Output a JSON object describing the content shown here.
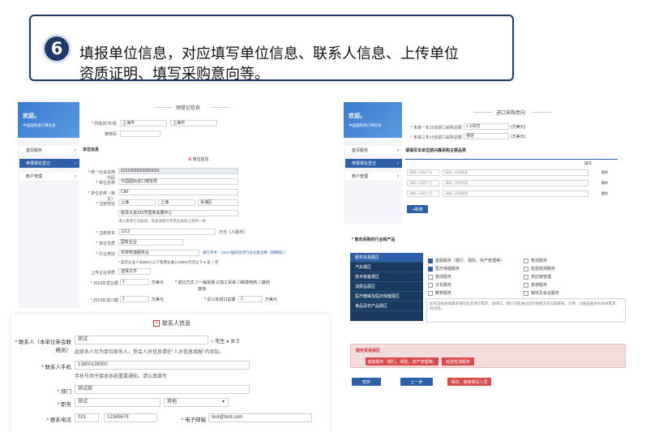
{
  "step": {
    "number": "6",
    "line1": "填报单位信息，对应填写单位信息、联系人信息、上传单位",
    "line2": "资质证明、填写采购意向等。"
  },
  "left_screen": {
    "welcome_title": "欢迎。",
    "welcome_sub": "中国国际进口博览会",
    "nav": [
      "首页服务",
      "参展报名登记",
      "账户管理"
    ],
    "section_title": "预登记信息",
    "row1_label": "* 所属省/市/县",
    "row1_v1": "上海市",
    "row1_v2": "上海市",
    "row2_label": "推荐码",
    "unit_heading": "单位信息",
    "unit_info_title": "单位信息",
    "credit_code_label": "* 统一社会信用代码",
    "credit_code_value": "9131000000000000X",
    "unit_name_label": "* 单位名称",
    "unit_name_value": "中国国际进口博览局",
    "unit_name_en_label": "* 单位名称（英文）",
    "unit_name_en_value": "CIIE",
    "address_label": "* 注册地址",
    "address_v1": "上海",
    "address_v2": "上海",
    "address_v3": "青浦区",
    "street_value": "崧泽大道333号国家会展中心",
    "address_note": "请认真填写注册地，如查请填写和营业执照上保持一致",
    "capital_label": "* 注册资本",
    "capital_value": "1212",
    "capital_unit": "万元（人民币）",
    "nature_label": "* 单位性质",
    "nature_value": "国有企业",
    "industry_label": "* 行业类别",
    "industry_value": "农林牧渔服务业",
    "industry_link": "填写参考：《2017国民经济行业分类注释（网络版）》",
    "scale_label": "* 单位规模",
    "scale_note": "* 是否从业人员300人以下或营业收入10000万元以下",
    "scale_yes": "是",
    "scale_no": "否",
    "upload_label": "上传企业资质",
    "upload_value": "选择文件",
    "sales_label": "* 2018年营业额",
    "sales_value": "1",
    "sales_unit": "万美元",
    "import_label": "* 进口方式",
    "import_opts": [
      "一般贸易",
      "加工贸易",
      "跨境电商",
      "其他"
    ],
    "import_extra": "其他",
    "import_2018_label": "* 2018年进口额",
    "import_2018_value": "1",
    "import_2018_unit": "万美元",
    "import_3y_label": "* 近三年进口总额",
    "import_3y_value": "1",
    "import_3y_unit": "万美元"
  },
  "contact": {
    "title": "联系人信息",
    "name_label": "* 联系人（本单位参会联络员）",
    "name_value": "测试",
    "gender_male": "先生",
    "gender_female": "女士",
    "name_note": "此联系人仅为单位联系人，参会人员信息请在\"人员信息填报\"内添加。",
    "phone_label": "* 联系人手机",
    "phone_value": "13800138000",
    "phone_note": "手机号用于接收系统重要通知，请认真填写",
    "dept_label": "* 部门",
    "dept_value": "测试部",
    "position_label": "* 职务",
    "position_value": "测试",
    "position_select": "其他",
    "tel_label": "* 联系电话",
    "tel_area": "021",
    "tel_num": "12345678",
    "email_label": "* 电子邮箱",
    "email_value": "test@test.com"
  },
  "right_screen": {
    "welcome_title": "欢迎。",
    "welcome_sub": "中国国际进口博览会",
    "nav": [
      "首页服务",
      "参展报名登记",
      "账户管理"
    ],
    "section_title": "进口采购意向",
    "q1_label": "* 未来一年计划进口采购总额",
    "q1_value": "< 100万",
    "q1_unit": "(万美元)",
    "q2_label": "* 未来三年计划进口采购总额",
    "q2_value": "待定",
    "q2_unit": "(万美元)",
    "table_heading": "请填写本单位感兴趣采购主要品类",
    "col_op": "操作",
    "row_placeholder": "请输入采购产品",
    "row_placeholder2": "请输入采购数量",
    "row_btn": "删除",
    "add_btn": "+新增",
    "industry_title": "* 意向采购的行业和产品",
    "industry_menu": [
      "服务贸易展区",
      "汽车展区",
      "技术装备展区",
      "消费品展区",
      "医疗器械及医药保健展区",
      "食品及农产品展区"
    ],
    "checks_col1": [
      "金融服务（银行、保险、资产管理等）",
      "医疗保健服务",
      "物流服务",
      "文化服务",
      "教育服务"
    ],
    "checks_col2": [
      "物流服务",
      "检验检测服务",
      "供应链管理",
      "旅游服务",
      "媒体及会议服务"
    ],
    "textarea_note": "如有其他采购需求请在此处填写需求，请填写。我们可能通过您的联络方式与您联系，示例：对展品服务的具体需求、时间等。",
    "selected_title": "服务贸易展区",
    "selected_tags": [
      "金融服务（银行、保险、资产管理等）",
      "检验检测服务"
    ],
    "btn_save": "暂存",
    "btn_prev": "上一步",
    "btn_next": "保存，继续填写人员"
  }
}
